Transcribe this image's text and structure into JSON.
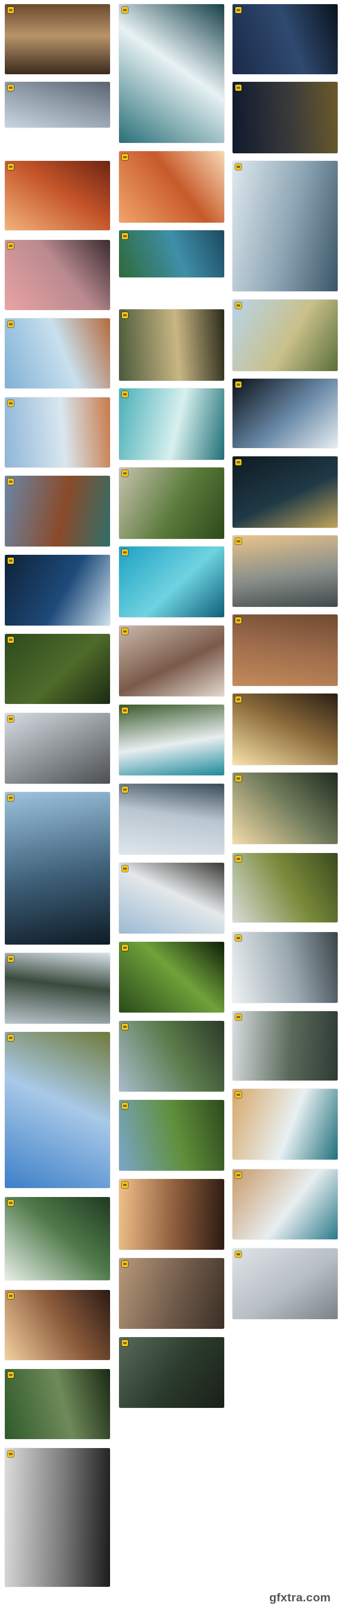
{
  "watermark": "gfxtra.com",
  "badge_color": "#f0c419",
  "columns": [
    {
      "tiles": [
        {
          "id": "sandy-rocks-debris",
          "g": [
            "#3b2a1d",
            "#b8946a",
            "#6b4a2c"
          ]
        },
        {
          "id": "icy-coastline-cliff",
          "g": [
            "#c9d6e2",
            "#8e9aa6",
            "#5a6470"
          ]
        },
        {
          "id": "red-canyon-slot",
          "g": [
            "#f2b37a",
            "#c4542a",
            "#6e2412"
          ]
        },
        {
          "id": "woman-by-sea-cliff",
          "g": [
            "#e9a3a3",
            "#b98a8f",
            "#3b2b30"
          ]
        },
        {
          "id": "house-on-rock-pillar",
          "g": [
            "#7fb1d6",
            "#c9e0ee",
            "#b46a3c"
          ]
        },
        {
          "id": "cottage-on-red-rock",
          "g": [
            "#8fb6d8",
            "#d9e7f0",
            "#c97a4a"
          ]
        },
        {
          "id": "grand-canyon-river",
          "g": [
            "#6a86a6",
            "#8a4a2a",
            "#2f6f6a"
          ]
        },
        {
          "id": "iceberg-dark-sea",
          "g": [
            "#0f2238",
            "#1e4a7a",
            "#cfe2ee"
          ]
        },
        {
          "id": "fern-forest-path",
          "g": [
            "#2c4a1e",
            "#4f6b2a",
            "#1b2a12"
          ]
        },
        {
          "id": "frosty-leaves-ice",
          "g": [
            "#d6dde3",
            "#8a8f93",
            "#4b4f52"
          ]
        },
        {
          "id": "alpine-lake-village",
          "g": [
            "#9cc3de",
            "#3e5f78",
            "#0e1c26"
          ]
        },
        {
          "id": "waterfall-cliffs",
          "g": [
            "#b9c4cb",
            "#3a4a3d",
            "#d8e3ea"
          ]
        },
        {
          "id": "mesa-under-sky",
          "g": [
            "#3d7fc8",
            "#a9c9e8",
            "#6f7a3a"
          ]
        },
        {
          "id": "mirror-lake-hills",
          "g": [
            "#e8efe9",
            "#4f7a4a",
            "#1f3a22"
          ]
        },
        {
          "id": "misty-sunset-ridge",
          "g": [
            "#f3d0a0",
            "#8a5a3a",
            "#2b1a14"
          ]
        },
        {
          "id": "rope-bridge-jungle",
          "g": [
            "#2f5a2a",
            "#6f8a5a",
            "#1a2a14"
          ]
        },
        {
          "id": "dreamcatcher-fog",
          "g": [
            "#dcdcdc",
            "#7a7a7a",
            "#1c1c1c"
          ]
        }
      ]
    },
    {
      "tiles": [
        {
          "id": "crashing-wave-top",
          "g": [
            "#2a6f78",
            "#e8f2f4",
            "#17404a"
          ]
        },
        {
          "id": "wave-sandstone",
          "g": [
            "#f2a46a",
            "#c75a2a",
            "#f7d8b4"
          ]
        },
        {
          "id": "tropical-coast-trees",
          "g": [
            "#2f6a3a",
            "#3f8fa8",
            "#1c4a62"
          ]
        },
        {
          "id": "boat-on-misty-lake",
          "g": [
            "#4a5a3a",
            "#c9b684",
            "#2a2a1a"
          ]
        },
        {
          "id": "turquoise-surf",
          "g": [
            "#4ab0b8",
            "#d8f0ef",
            "#1f6f76"
          ]
        },
        {
          "id": "green-terraced-hills",
          "g": [
            "#c7c2ae",
            "#5a7a3a",
            "#2c4a1c"
          ]
        },
        {
          "id": "shark-in-lagoon",
          "g": [
            "#1fa1c4",
            "#6fd3e0",
            "#0e5f7a"
          ]
        },
        {
          "id": "layered-rock-strata",
          "g": [
            "#c9b8aa",
            "#7a5a4a",
            "#e3d8cf"
          ]
        },
        {
          "id": "aerial-beach-surf",
          "g": [
            "#3a5a2a",
            "#e8eef0",
            "#1c8a9a"
          ]
        },
        {
          "id": "lighthouse-in-fog",
          "g": [
            "#dfe6ec",
            "#b9c6d0",
            "#3a4a58"
          ]
        },
        {
          "id": "clouds-over-ridge",
          "g": [
            "#9bbad4",
            "#e4e8ea",
            "#3a3a34"
          ]
        },
        {
          "id": "palm-frond-closeup",
          "g": [
            "#2a4a1a",
            "#6fa23a",
            "#0f1e0a"
          ]
        },
        {
          "id": "crater-lake-hills",
          "g": [
            "#a8bccb",
            "#5a7a4a",
            "#2c3a2a"
          ]
        },
        {
          "id": "green-valley-slope",
          "g": [
            "#7aa6c8",
            "#5f8f3a",
            "#2e4a1e"
          ]
        },
        {
          "id": "eagle-over-rocks",
          "g": [
            "#f0c08a",
            "#8a5a3a",
            "#2a1a12"
          ]
        },
        {
          "id": "dried-clay-cracks",
          "g": [
            "#b89a7a",
            "#6f5a4a",
            "#3a2e24"
          ]
        },
        {
          "id": "forest-light-rays",
          "g": [
            "#5a6a5a",
            "#2a3a2a",
            "#1a1f1a"
          ]
        }
      ]
    },
    {
      "tiles": [
        {
          "id": "night-mountain-lake",
          "g": [
            "#1a2a4a",
            "#2f4a6f",
            "#0a121e"
          ]
        },
        {
          "id": "starry-desert",
          "g": [
            "#0f1a2e",
            "#3a3a3a",
            "#6b5a2a"
          ]
        },
        {
          "id": "white-breaking-wave",
          "g": [
            "#dfe8ee",
            "#8aa3b2",
            "#3a5566"
          ]
        },
        {
          "id": "boardwalk-dunes",
          "g": [
            "#b8d4ea",
            "#c9c08a",
            "#5a6f3a"
          ]
        },
        {
          "id": "dewy-spider-web",
          "g": [
            "#0c1118",
            "#6a8aa8",
            "#e8eef2"
          ]
        },
        {
          "id": "lone-lamp-night",
          "g": [
            "#0e1a22",
            "#1f3a46",
            "#c2a45a"
          ]
        },
        {
          "id": "foggy-mountain-layers",
          "g": [
            "#e9c48a",
            "#8a8f8a",
            "#3f4a4a"
          ]
        },
        {
          "id": "aerial-farm-fields",
          "g": [
            "#c48a5a",
            "#9a6a4a",
            "#6f4a32"
          ]
        },
        {
          "id": "sunlit-portrait-field",
          "g": [
            "#f7e2a8",
            "#8a6a3a",
            "#2a1f14"
          ]
        },
        {
          "id": "waterfall-cave",
          "g": [
            "#f4dca8",
            "#6f7a5a",
            "#1f2a1f"
          ]
        },
        {
          "id": "mossy-lava-field",
          "g": [
            "#d8dcd8",
            "#7a8a3a",
            "#3a4a1e"
          ]
        },
        {
          "id": "snowy-river-gorge",
          "g": [
            "#eef2f4",
            "#9aa8b0",
            "#3a444a"
          ]
        },
        {
          "id": "highland-lake",
          "g": [
            "#d8dde0",
            "#5a6a5a",
            "#2e3a34"
          ]
        },
        {
          "id": "aerial-surf-sand",
          "g": [
            "#d8a86a",
            "#e8f0f2",
            "#1f6f7a"
          ]
        },
        {
          "id": "beach-footprints",
          "g": [
            "#c99a6a",
            "#e8eef0",
            "#2a7a8a"
          ]
        },
        {
          "id": "white-horse-snow",
          "g": [
            "#dfe4e8",
            "#b7bec4",
            "#7a8288"
          ]
        }
      ]
    }
  ]
}
